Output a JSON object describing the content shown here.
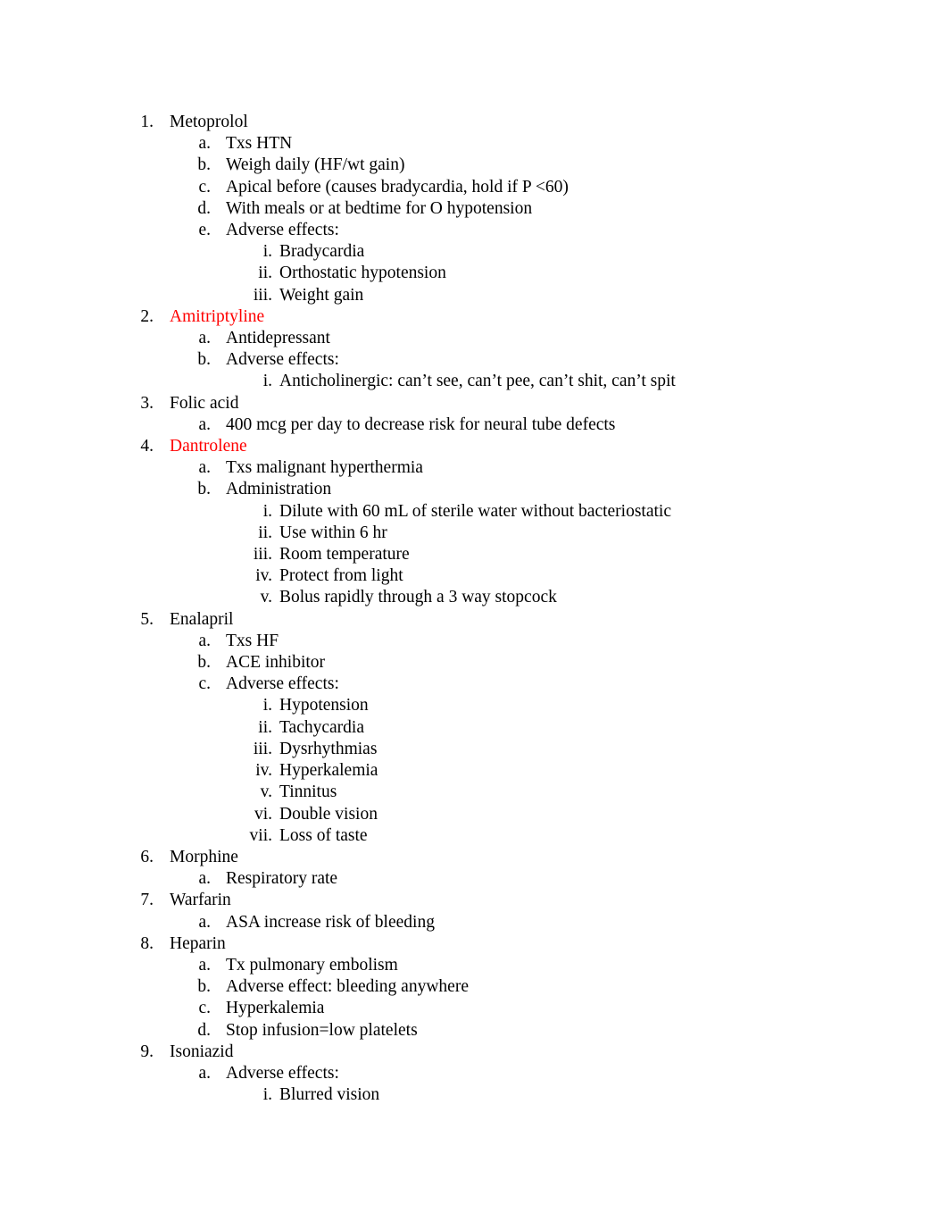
{
  "document": {
    "accent_color": "#ff0000",
    "text_color": "#000000",
    "background_color": "#ffffff"
  },
  "outline": [
    {
      "marker": "1.",
      "label": "Metoprolol",
      "color": "black",
      "children": [
        {
          "marker": "a.",
          "label": "Txs HTN",
          "color": "black"
        },
        {
          "marker": "b.",
          "label": "Weigh daily (HF/wt gain)",
          "color": "black"
        },
        {
          "marker": "c.",
          "label": "Apical before (causes bradycardia, hold if P <60)",
          "color": "black"
        },
        {
          "marker": "d.",
          "label": "With meals or at bedtime for O hypotension",
          "color": "black"
        },
        {
          "marker": "e.",
          "label": "Adverse effects:",
          "color": "black",
          "children": [
            {
              "marker": "i.",
              "label": "Bradycardia",
              "color": "black"
            },
            {
              "marker": "ii.",
              "label": "Orthostatic hypotension",
              "color": "black"
            },
            {
              "marker": "iii.",
              "label": "Weight gain",
              "color": "black"
            }
          ]
        }
      ]
    },
    {
      "marker": "2.",
      "label": "Amitriptyline",
      "color": "red",
      "children": [
        {
          "marker": "a.",
          "label": "Antidepressant",
          "color": "black"
        },
        {
          "marker": "b.",
          "label": "Adverse effects:",
          "color": "black",
          "children": [
            {
              "marker": "i.",
              "label": "Anticholinergic: can’t see, can’t pee, can’t shit, can’t spit",
              "color": "black"
            }
          ]
        }
      ]
    },
    {
      "marker": "3.",
      "label": "Folic acid",
      "color": "black",
      "children": [
        {
          "marker": "a.",
          "label": "400 mcg per day to decrease risk for neural tube defects",
          "color": "black"
        }
      ]
    },
    {
      "marker": "4.",
      "label": "Dantrolene",
      "color": "red",
      "children": [
        {
          "marker": "a.",
          "label": "Txs malignant hyperthermia",
          "color": "black"
        },
        {
          "marker": "b.",
          "label": "Administration",
          "color": "black",
          "children": [
            {
              "marker": "i.",
              "label": "Dilute with 60 mL of sterile water without bacteriostatic",
              "color": "black"
            },
            {
              "marker": "ii.",
              "label": "Use within 6 hr",
              "color": "black"
            },
            {
              "marker": "iii.",
              "label": "Room temperature",
              "color": "black"
            },
            {
              "marker": "iv.",
              "label": "Protect from light",
              "color": "black"
            },
            {
              "marker": "v.",
              "label": "Bolus rapidly through a 3 way stopcock",
              "color": "black"
            }
          ]
        }
      ]
    },
    {
      "marker": "5.",
      "label": "Enalapril",
      "color": "black",
      "children": [
        {
          "marker": "a.",
          "label": "Txs HF",
          "color": "black"
        },
        {
          "marker": "b.",
          "label": "ACE inhibitor",
          "color": "black"
        },
        {
          "marker": "c.",
          "label": "Adverse effects:",
          "color": "black",
          "children": [
            {
              "marker": "i.",
              "label": "Hypotension",
              "color": "black"
            },
            {
              "marker": "ii.",
              "label": "Tachycardia",
              "color": "black"
            },
            {
              "marker": "iii.",
              "label": "Dysrhythmias",
              "color": "black"
            },
            {
              "marker": "iv.",
              "label": "Hyperkalemia",
              "color": "black"
            },
            {
              "marker": "v.",
              "label": "Tinnitus",
              "color": "black"
            },
            {
              "marker": "vi.",
              "label": "Double vision",
              "color": "black"
            },
            {
              "marker": "vii.",
              "label": "Loss of taste",
              "color": "black"
            }
          ]
        }
      ]
    },
    {
      "marker": "6.",
      "label": "Morphine",
      "color": "black",
      "children": [
        {
          "marker": "a.",
          "label": "Respiratory rate",
          "color": "black"
        }
      ]
    },
    {
      "marker": "7.",
      "label": "Warfarin",
      "color": "black",
      "children": [
        {
          "marker": "a.",
          "label": "ASA increase risk of bleeding",
          "color": "black"
        }
      ]
    },
    {
      "marker": "8.",
      "label": "Heparin",
      "color": "black",
      "children": [
        {
          "marker": "a.",
          "label": "Tx pulmonary embolism",
          "color": "black"
        },
        {
          "marker": "b.",
          "label": "Adverse effect: bleeding anywhere",
          "color": "black"
        },
        {
          "marker": "c.",
          "label": "Hyperkalemia",
          "color": "black"
        },
        {
          "marker": "d.",
          "label": "Stop infusion=low platelets",
          "color": "black"
        }
      ]
    },
    {
      "marker": "9.",
      "label": "Isoniazid",
      "color": "black",
      "children": [
        {
          "marker": "a.",
          "label": "Adverse effects:",
          "color": "black",
          "children": [
            {
              "marker": "i.",
              "label": "Blurred vision",
              "color": "black"
            }
          ]
        }
      ]
    }
  ]
}
